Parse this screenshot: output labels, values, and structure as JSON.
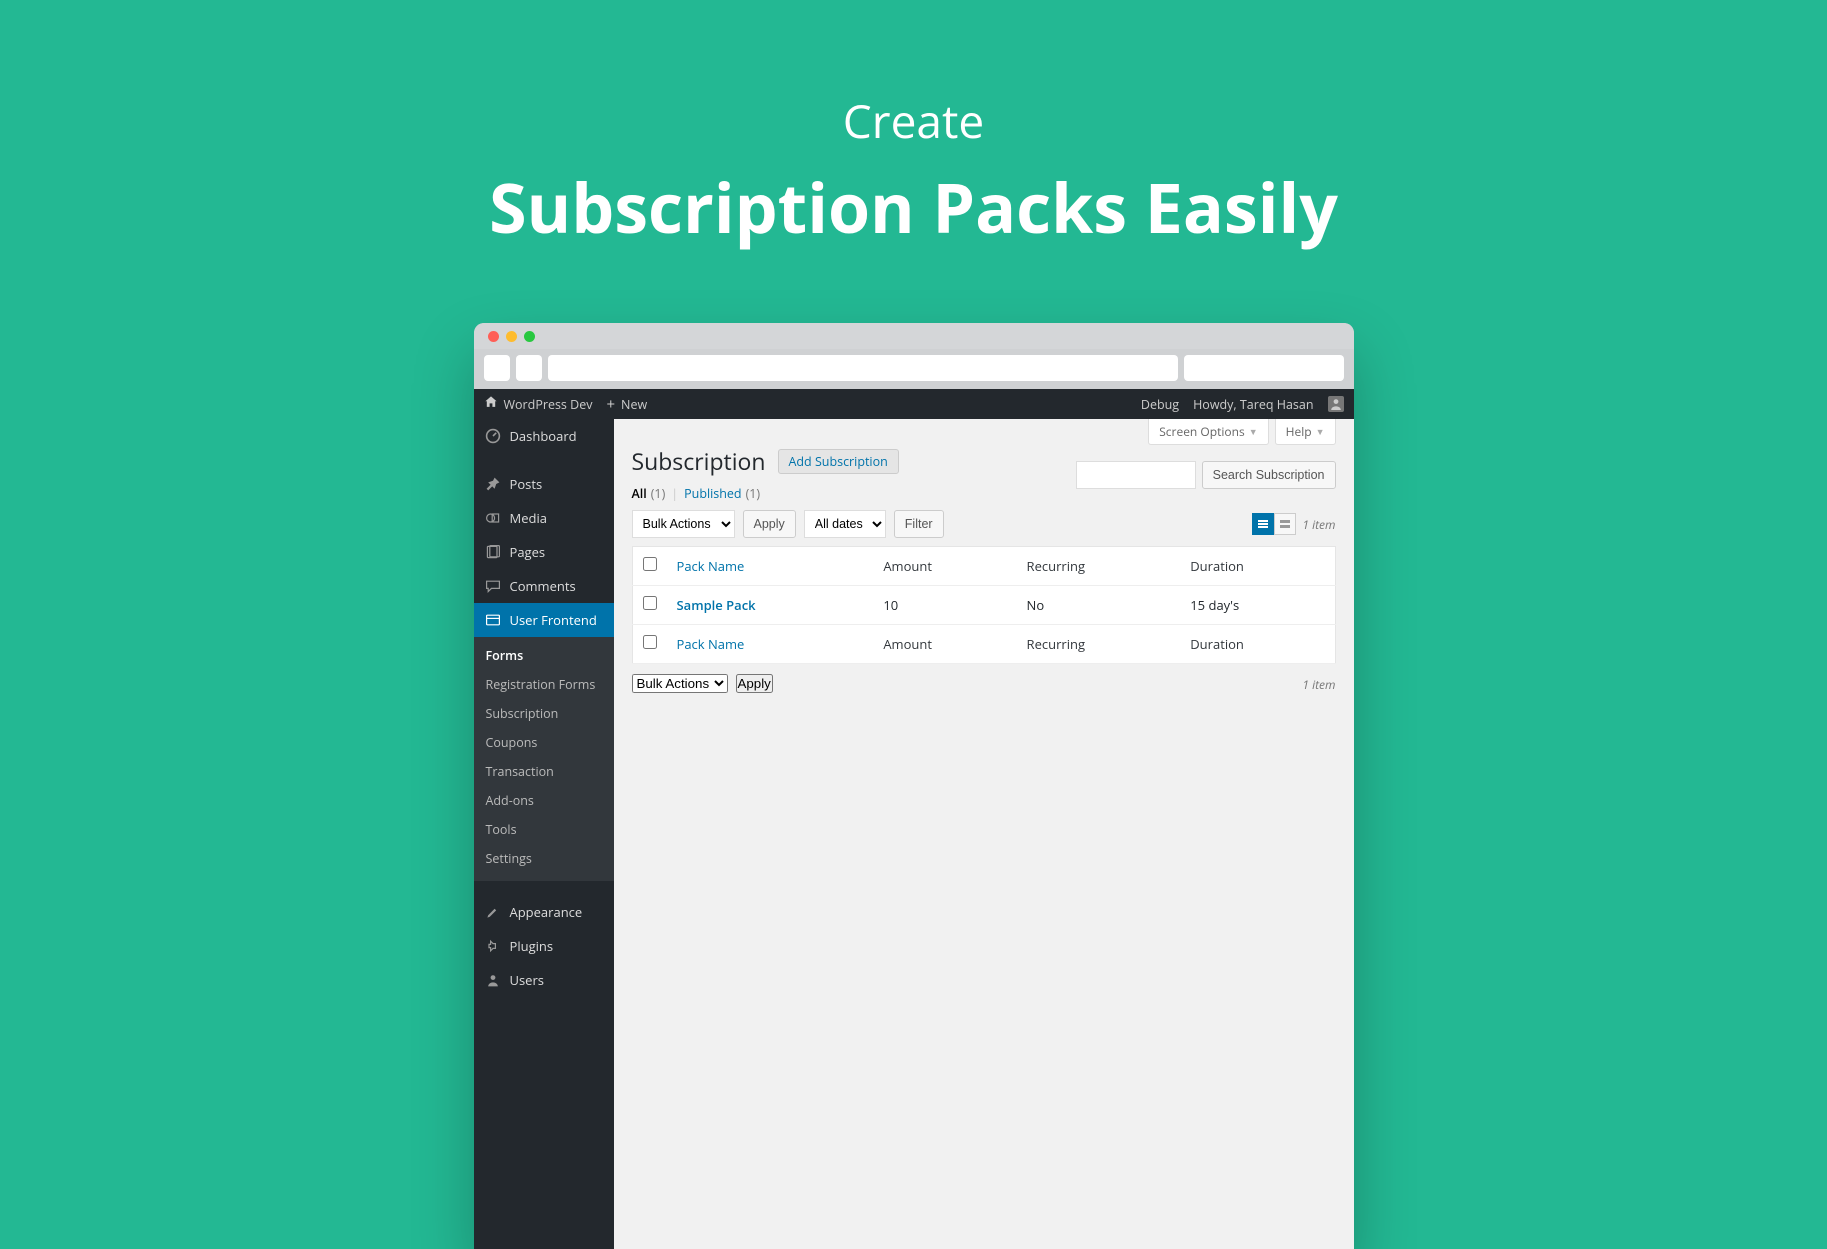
{
  "hero": {
    "line1": "Create",
    "line2": "Subscription Packs Easily"
  },
  "adminbar": {
    "site_name": "WordPress Dev",
    "new_label": "New",
    "debug": "Debug",
    "howdy": "Howdy, Tareq Hasan"
  },
  "sidebar": {
    "items": [
      {
        "label": "Dashboard",
        "icon": "dashboard"
      },
      {
        "label": "Posts",
        "icon": "pin"
      },
      {
        "label": "Media",
        "icon": "media"
      },
      {
        "label": "Pages",
        "icon": "page"
      },
      {
        "label": "Comments",
        "icon": "comment"
      },
      {
        "label": "User Frontend",
        "icon": "frontend"
      },
      {
        "label": "Appearance",
        "icon": "brush"
      },
      {
        "label": "Plugins",
        "icon": "plug"
      },
      {
        "label": "Users",
        "icon": "user"
      }
    ],
    "submenu": [
      "Forms",
      "Registration Forms",
      "Subscription",
      "Coupons",
      "Transaction",
      "Add-ons",
      "Tools",
      "Settings"
    ]
  },
  "screen_meta": {
    "screen_options": "Screen Options",
    "help": "Help"
  },
  "page": {
    "title": "Subscription",
    "add_new": "Add Subscription",
    "filters": {
      "all_label": "All",
      "all_count": "(1)",
      "published_label": "Published",
      "published_count": "(1)"
    },
    "search_button": "Search Subscription",
    "bulk_actions": "Bulk Actions",
    "apply": "Apply",
    "all_dates": "All dates",
    "filter": "Filter",
    "item_count": "1 item",
    "columns": {
      "pack_name": "Pack Name",
      "amount": "Amount",
      "recurring": "Recurring",
      "duration": "Duration"
    },
    "rows": [
      {
        "pack_name": "Sample Pack",
        "amount": "10",
        "recurring": "No",
        "duration": "15 day's"
      }
    ]
  }
}
